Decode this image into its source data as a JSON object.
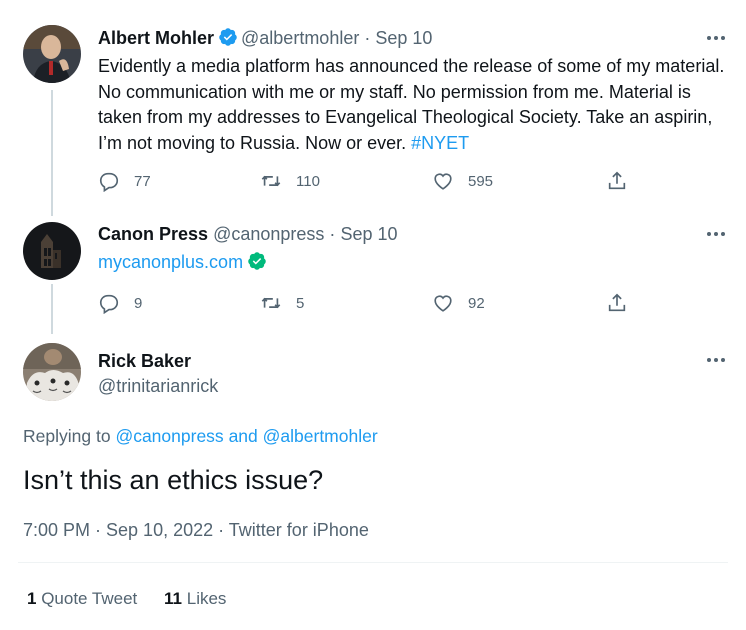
{
  "tweets": [
    {
      "name": "Albert Mohler",
      "handle": "@albertmohler",
      "separator": "·",
      "date": "Sep 10",
      "text_before_hashtag": "Evidently a media platform has announced the release of some of my material. No communication with me or my staff. No permission from me. Material is taken from my addresses to Evangelical Theological Society. Take an aspirin, I’m not moving to Russia. Now or ever. ",
      "hashtag": "#NYET",
      "replies": "77",
      "retweets": "110",
      "likes": "595"
    },
    {
      "name": "Canon Press",
      "handle": "@canonpress",
      "separator": "·",
      "date": "Sep 10",
      "link": "mycanonplus.com",
      "replies": "9",
      "retweets": "5",
      "likes": "92"
    }
  ],
  "main_tweet": {
    "name": "Rick Baker",
    "handle": "@trinitarianrick",
    "replying_prefix": "Replying to",
    "replying_mention_1": "@canonpress",
    "replying_and": "and",
    "replying_mention_2": "@albertmohler",
    "text": "Isn’t this an ethics issue?",
    "meta": "7:00 PM · Sep 10, 2022 · Twitter for iPhone",
    "quote_tweets_count": "1",
    "quote_tweets_label": "Quote Tweet",
    "likes_count": "11",
    "likes_label": "Likes"
  },
  "colors": {
    "accent": "#1d9bf0",
    "verified_blue": "#1d9bf0",
    "verified_green": "#00ba7c",
    "secondary_text": "#536471"
  },
  "icons": {
    "reply": "reply-icon",
    "retweet": "retweet-icon",
    "like": "like-icon",
    "share": "share-icon",
    "more": "more-icon",
    "verified": "verified-badge-icon"
  }
}
